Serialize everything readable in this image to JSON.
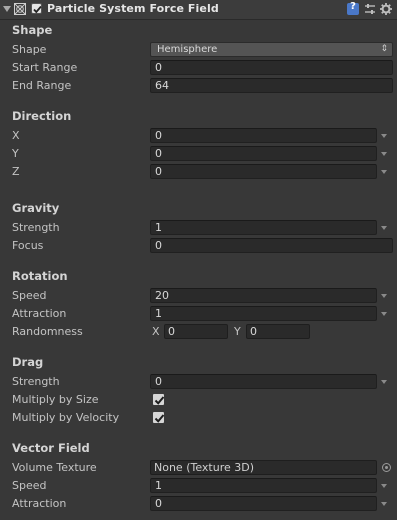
{
  "header": {
    "title": "Particle System Force Field",
    "enabled": true,
    "icons": [
      "foldout-arrow-icon",
      "force-field-icon",
      "help-book-icon",
      "preset-sliders-icon",
      "gear-icon"
    ]
  },
  "shape": {
    "section": "Shape",
    "shape_label": "Shape",
    "shape_value": "Hemisphere",
    "start_label": "Start Range",
    "start_value": "0",
    "end_label": "End Range",
    "end_value": "64"
  },
  "direction": {
    "section": "Direction",
    "x_label": "X",
    "x_value": "0",
    "y_label": "Y",
    "y_value": "0",
    "z_label": "Z",
    "z_value": "0"
  },
  "gravity": {
    "section": "Gravity",
    "strength_label": "Strength",
    "strength_value": "1",
    "focus_label": "Focus",
    "focus_value": "0"
  },
  "rotation": {
    "section": "Rotation",
    "speed_label": "Speed",
    "speed_value": "20",
    "attraction_label": "Attraction",
    "attraction_value": "1",
    "randomness_label": "Randomness",
    "rx_label": "X",
    "rx_value": "0",
    "ry_label": "Y",
    "ry_value": "0"
  },
  "drag": {
    "section": "Drag",
    "strength_label": "Strength",
    "strength_value": "0",
    "size_label": "Multiply by Size",
    "size_checked": true,
    "velocity_label": "Multiply by Velocity",
    "velocity_checked": true
  },
  "vector_field": {
    "section": "Vector Field",
    "texture_label": "Volume Texture",
    "texture_value": "None (Texture 3D)",
    "speed_label": "Speed",
    "speed_value": "1",
    "attraction_label": "Attraction",
    "attraction_value": "0"
  },
  "colors": {
    "background": "#383838",
    "field": "#2a2a2a",
    "enum": "#545454",
    "help": "#4a78c8"
  }
}
